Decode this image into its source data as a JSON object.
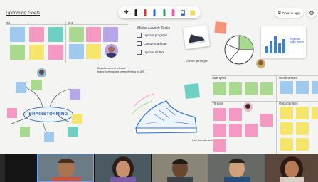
{
  "board": {
    "title": "Upcoming Goals",
    "q3_label": "Q3",
    "q4_label": "Q4",
    "tasks_title": "Maker Launch Tasks",
    "tasks": [
      "Update progress",
      "Create roadmap",
      "Update all Pxs"
    ],
    "note_brand": "Brand treatment relevant brand or elongated release",
    "note_pricing": "Pricing for AIS",
    "sneaker_caption": "Can we get the gift?",
    "shoe_caption": "Like the color and style",
    "brainstorming": "BRAINSTORMING",
    "strengths": "Strengths",
    "weaknesses": "Weaknesses",
    "threats": "Threats",
    "opportunities": "Opportunities",
    "chart_card_title": "Regional Sales Report",
    "colors": {
      "blue": "#9fc9ef",
      "green": "#a9d98f",
      "pink": "#f49ac2",
      "yellow": "#f5e56b",
      "purple": "#b7a7ea",
      "teal": "#6fcfc0"
    }
  },
  "toolbar": {
    "tools": [
      "select-icon",
      "pen-black-icon",
      "pen-red-icon",
      "pen-blue-icon",
      "pen-green-icon",
      "highlighter-icon",
      "eraser-icon",
      "sticky-note-icon"
    ],
    "open_in_app": "Open in app"
  },
  "participants": [
    "Participant 1",
    "Participant 2",
    "Participant 3",
    "Participant 4",
    "Participant 5"
  ]
}
